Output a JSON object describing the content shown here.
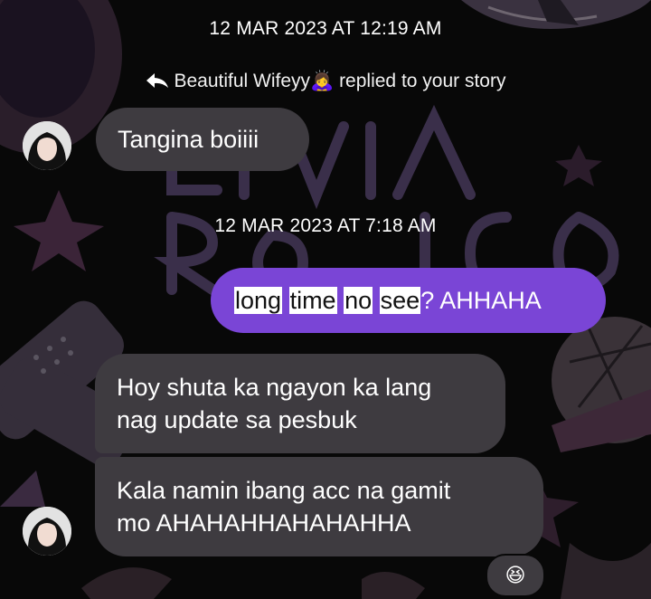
{
  "timestamps": [
    "12 MAR 2023 AT 12:19 AM",
    "12 MAR 2023 AT 7:18 AM"
  ],
  "reply_note": {
    "icon": "reply-arrow-icon",
    "name": "Beautiful Wifeyy",
    "emoji": "🙇‍♀️",
    "text": "replied to your story"
  },
  "messages": [
    {
      "direction": "incoming",
      "text": "Tangina boiiii"
    },
    {
      "direction": "outgoing",
      "parts": [
        "long",
        " ",
        "time",
        " ",
        "no",
        " ",
        "see",
        "? AHHAHA"
      ]
    },
    {
      "direction": "incoming",
      "lines": [
        "Hoy shuta ka ngayon ka lang",
        "nag update sa pesbuk"
      ]
    },
    {
      "direction": "incoming",
      "lines": [
        "Kala namin ibang acc na gamit",
        "mo AHAHAHHAHAHAHHA"
      ]
    }
  ],
  "reaction": {
    "emoji": "😆"
  },
  "colors": {
    "background": "#080808",
    "incoming_bubble": "#3e3b40",
    "outgoing_bubble": "#7a45d6",
    "text": "#ffffff",
    "highlight": "#ffffff"
  }
}
